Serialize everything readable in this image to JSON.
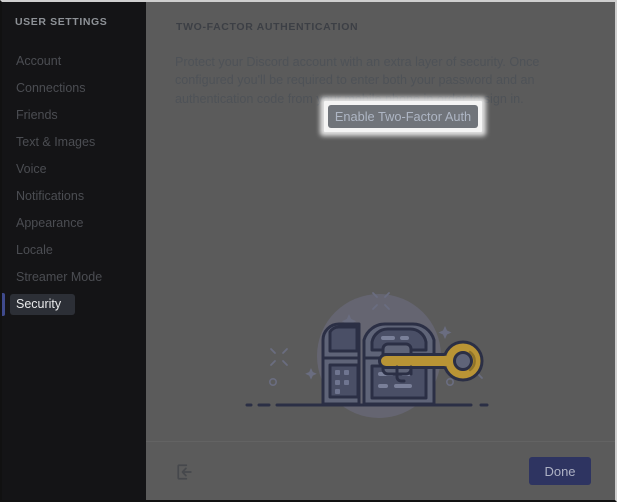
{
  "sidebar": {
    "title": "USER SETTINGS",
    "items": [
      {
        "label": "Account",
        "active": false
      },
      {
        "label": "Connections",
        "active": false
      },
      {
        "label": "Friends",
        "active": false
      },
      {
        "label": "Text & Images",
        "active": false
      },
      {
        "label": "Voice",
        "active": false
      },
      {
        "label": "Notifications",
        "active": false
      },
      {
        "label": "Appearance",
        "active": false
      },
      {
        "label": "Locale",
        "active": false
      },
      {
        "label": "Streamer Mode",
        "active": false
      },
      {
        "label": "Security",
        "active": true
      }
    ]
  },
  "main": {
    "section_heading": "TWO-FACTOR AUTHENTICATION",
    "section_body": "Protect your Discord account with an extra layer of security. Once configured you'll be required to enter both your password and an authentication code from your mobile phone in order to sign in.",
    "enable_button_label": "Enable Two-Factor Auth",
    "illustration_name": "treasure-chest-with-key-illustration"
  },
  "footer": {
    "logout_icon": "logout-icon",
    "done_label": "Done"
  },
  "colors": {
    "sidebar_bg": "#141416",
    "main_bg": "#5b5b5b",
    "active_accent": "#3f4a8c",
    "active_item_bg": "#2c2f36",
    "done_button_bg": "#2e3461",
    "highlight_glow": "#ffffff",
    "illustration_outline": "#2b2f45",
    "illustration_key": "#b99435",
    "illustration_fill": "#5f6478"
  }
}
